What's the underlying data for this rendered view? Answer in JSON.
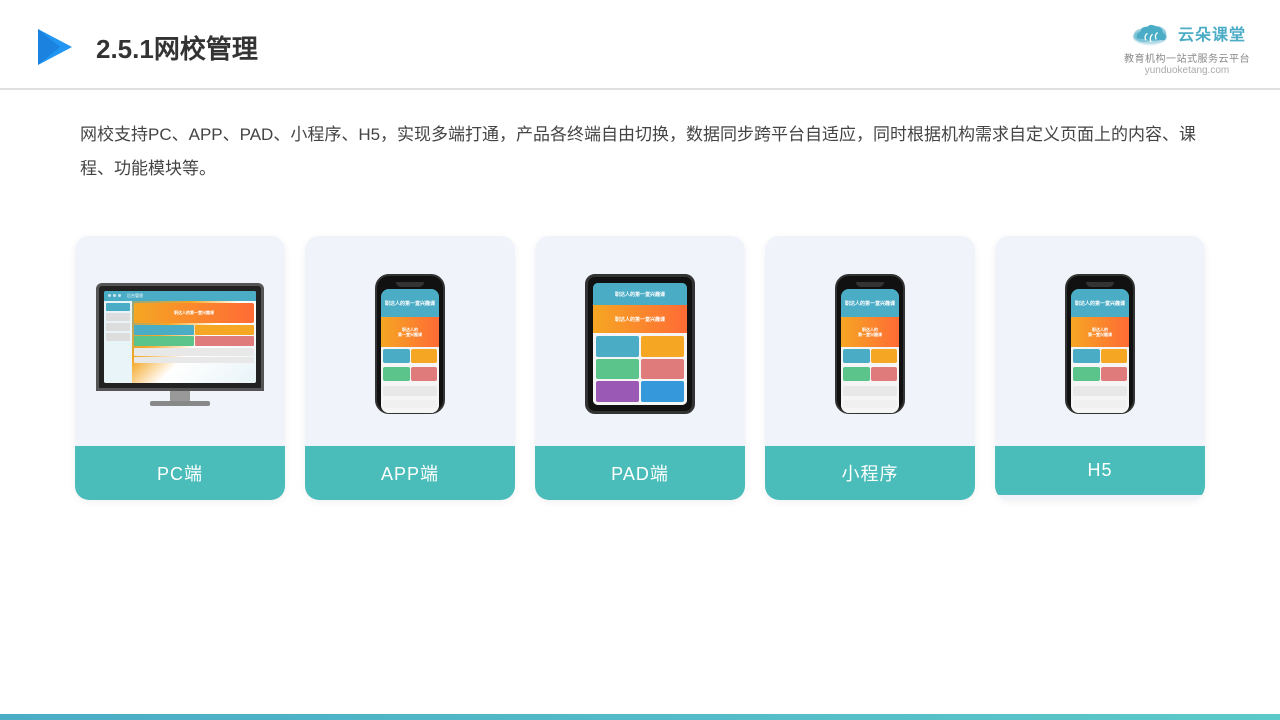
{
  "header": {
    "title": "2.5.1网校管理",
    "brand": {
      "name": "云朵课堂",
      "url": "yunduoketang.com",
      "tagline": "教育机构一站式服务云平台"
    }
  },
  "description": {
    "text": "网校支持PC、APP、PAD、小程序、H5，实现多端打通，产品各终端自由切换，数据同步跨平台自适应，同时根据机构需求自定义页面上的内容、课程、功能模块等。"
  },
  "cards": [
    {
      "label": "PC端",
      "type": "pc"
    },
    {
      "label": "APP端",
      "type": "phone"
    },
    {
      "label": "PAD端",
      "type": "tablet"
    },
    {
      "label": "小程序",
      "type": "phone"
    },
    {
      "label": "H5",
      "type": "phone"
    }
  ]
}
